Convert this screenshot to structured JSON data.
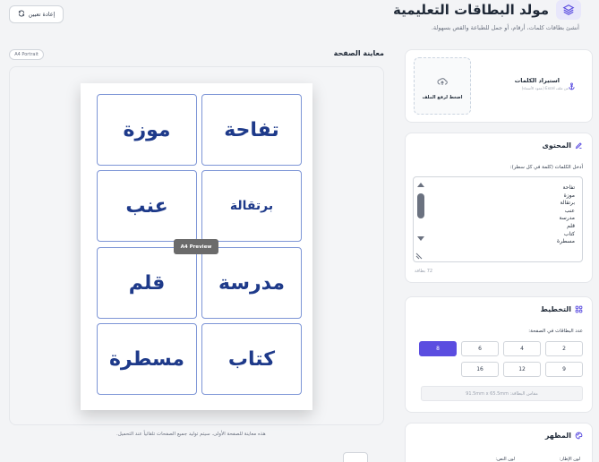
{
  "app": {
    "title": "مولد البطاقات التعليمية",
    "subtitle": "أنشئ بطاقات كلمات، أرقام، أو جمل للطباعة والقص بسهولة.",
    "reset_label": "إعادة تعيين"
  },
  "preview": {
    "title": "معاينة الصفحة",
    "badge": "A4 Portrait",
    "chip": "A4 Preview",
    "note": "هذه معاينة للصفحة الأولى. سيتم توليد جميع الصفحات تلقائياً عند التحميل.",
    "cards": [
      "تفاحة",
      "موزة",
      "برتقالة",
      "عنب",
      "مدرسة",
      "قلم",
      "كتاب",
      "مسطرة"
    ]
  },
  "import": {
    "title": "استيراد الكلمات",
    "subtitle": "من ملف Excel (عمود الأسماء)",
    "dropzone": "اضغط لرفع الملف"
  },
  "content": {
    "title": "المحتوى",
    "label": "أدخل الكلمات (كلمة في كل سطر):",
    "lines": [
      "تفاحة",
      "موزة",
      "برتقالة",
      "عنب",
      "مدرسة",
      "قلم",
      "كتاب",
      "مسطرة"
    ],
    "count": "72 بطاقة"
  },
  "layout": {
    "title": "التخطيط",
    "label": "عدد البطاقات في الصفحة:",
    "options": [
      "2",
      "4",
      "6",
      "8",
      "9",
      "12",
      "16"
    ],
    "selected": "8",
    "size": "مقاس البطاقة: 91.5mm x 65.5mm"
  },
  "appearance": {
    "title": "المظهر",
    "border_color_label": "لون الإطار:",
    "text_color_label": "لون النص:"
  },
  "colors": {
    "accent": "#5b4de0",
    "card_text": "#1e3a8a",
    "card_border": "#7d95d6"
  }
}
